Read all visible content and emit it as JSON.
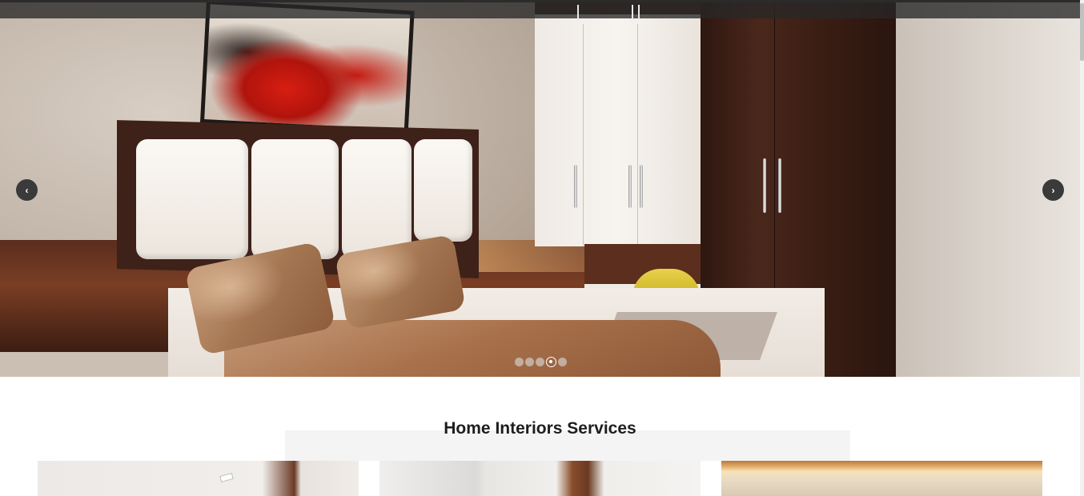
{
  "hero": {
    "image_label": "bedroom-interior-slide",
    "prev_icon": "chevron-left-icon",
    "next_icon": "chevron-right-icon",
    "prev_glyph": "‹",
    "next_glyph": "›",
    "slides_count": 5,
    "active_slide": 4
  },
  "services": {
    "title": "Home Interiors Services",
    "cards": [
      {
        "name": "service-card-1"
      },
      {
        "name": "service-card-2"
      },
      {
        "name": "service-card-3"
      }
    ]
  },
  "colors": {
    "nav_arrow_bg": "#3a3a3a",
    "title_text": "#1e1e1e",
    "topbar": "#2b2b2b"
  }
}
